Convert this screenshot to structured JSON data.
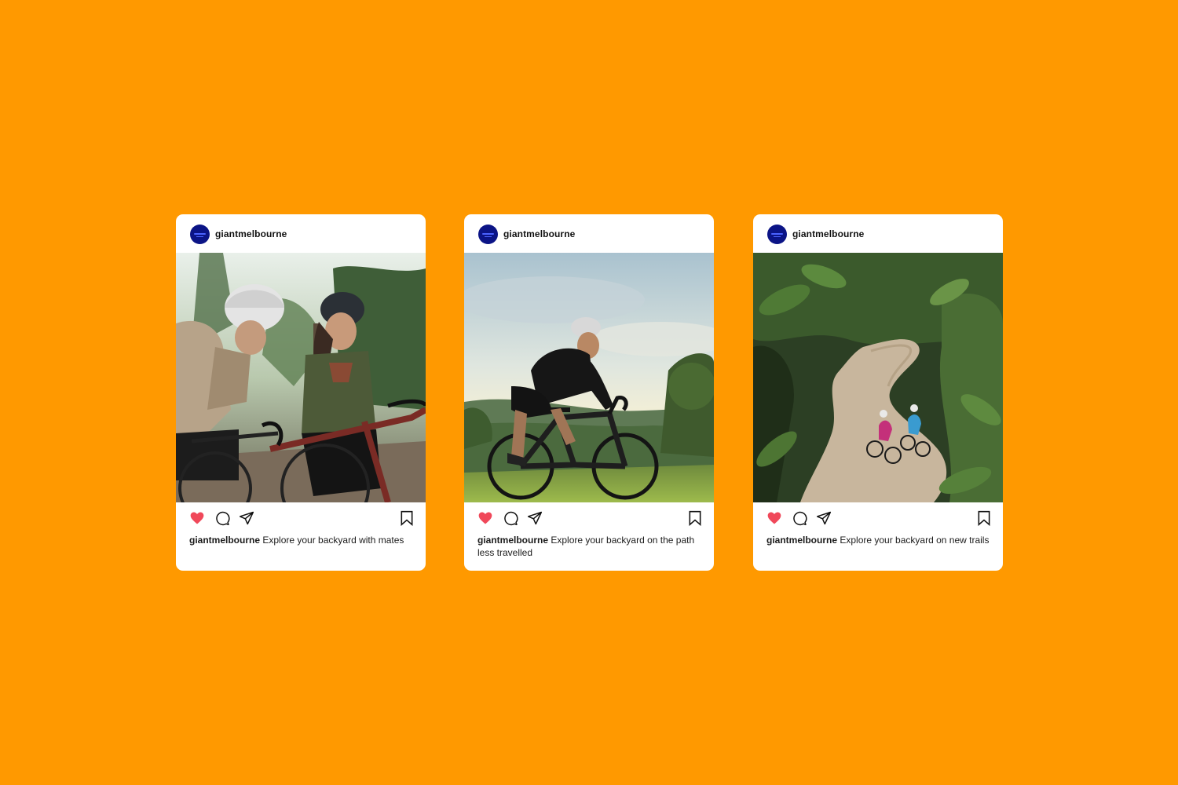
{
  "background_color": "#FF9900",
  "posts": [
    {
      "username": "giantmelbourne",
      "caption_user": "giantmelbourne",
      "caption_text": "Explore your backyard with mates",
      "liked": true
    },
    {
      "username": "giantmelbourne",
      "caption_user": "giantmelbourne",
      "caption_text": "Explore your backyard on the path less travelled",
      "liked": true
    },
    {
      "username": "giantmelbourne",
      "caption_user": "giantmelbourne",
      "caption_text": "Explore your backyard on new trails",
      "liked": true
    }
  ],
  "icons": {
    "like": "heart-icon",
    "comment": "comment-icon",
    "share": "send-icon",
    "save": "bookmark-icon"
  },
  "colors": {
    "like_red": "#F0485A",
    "avatar_blue": "#0B1486"
  }
}
